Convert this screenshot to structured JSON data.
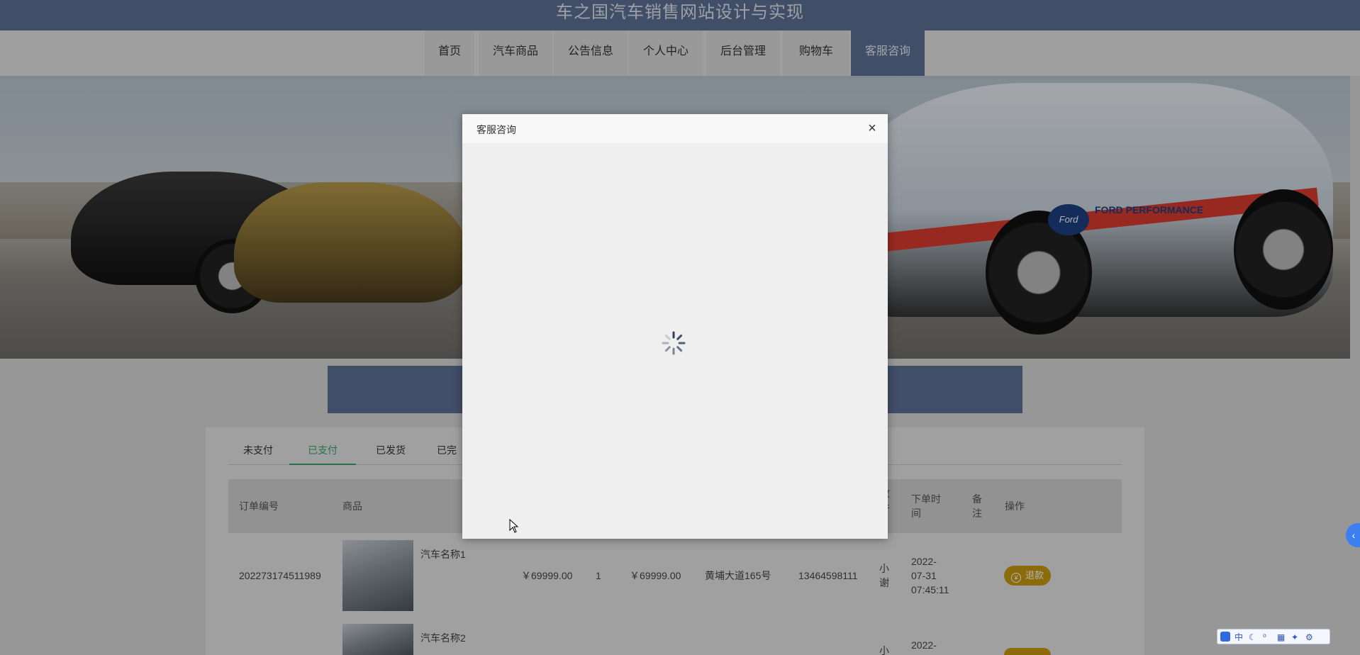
{
  "site": {
    "title": "车之国汽车销售网站设计与实现"
  },
  "nav": {
    "items": [
      {
        "label": "首页"
      },
      {
        "label": "汽车商品"
      },
      {
        "label": "公告信息"
      },
      {
        "label": "个人中心"
      },
      {
        "label": "后台管理"
      },
      {
        "label": "购物车"
      },
      {
        "label": "客服咨询"
      }
    ],
    "active": "客服咨询"
  },
  "banner": {
    "logo_text": "Ford",
    "brand_text": "FORD PERFORMANCE"
  },
  "orders": {
    "tabs": [
      {
        "label": "未支付"
      },
      {
        "label": "已支付"
      },
      {
        "label": "已发货"
      },
      {
        "label": "已完"
      }
    ],
    "active_tab": "已支付",
    "headers": {
      "order_no": "订单编号",
      "product": "商品",
      "receiver_partial": "收\n件",
      "order_time": "下单时\n间",
      "remark": "备\n注",
      "action": "操作"
    },
    "rows": [
      {
        "order_no": "202273174511989",
        "product_name": "汽车名称1",
        "price": "￥69999.00",
        "quantity": "1",
        "total": "￥69999.00",
        "address": "黄埔大道165号",
        "phone": "13464598111",
        "receiver": "小\n谢",
        "order_time": "2022-\n07-31\n07:45:11",
        "action": "退款"
      },
      {
        "product_name": "汽车名称2",
        "receiver": "小",
        "order_time": "2022-"
      }
    ]
  },
  "modal": {
    "title": "客服咨询",
    "close": "×"
  },
  "ime": {
    "items": [
      "中",
      "☾",
      "⁰",
      "▦",
      "✦",
      "⚙"
    ]
  }
}
